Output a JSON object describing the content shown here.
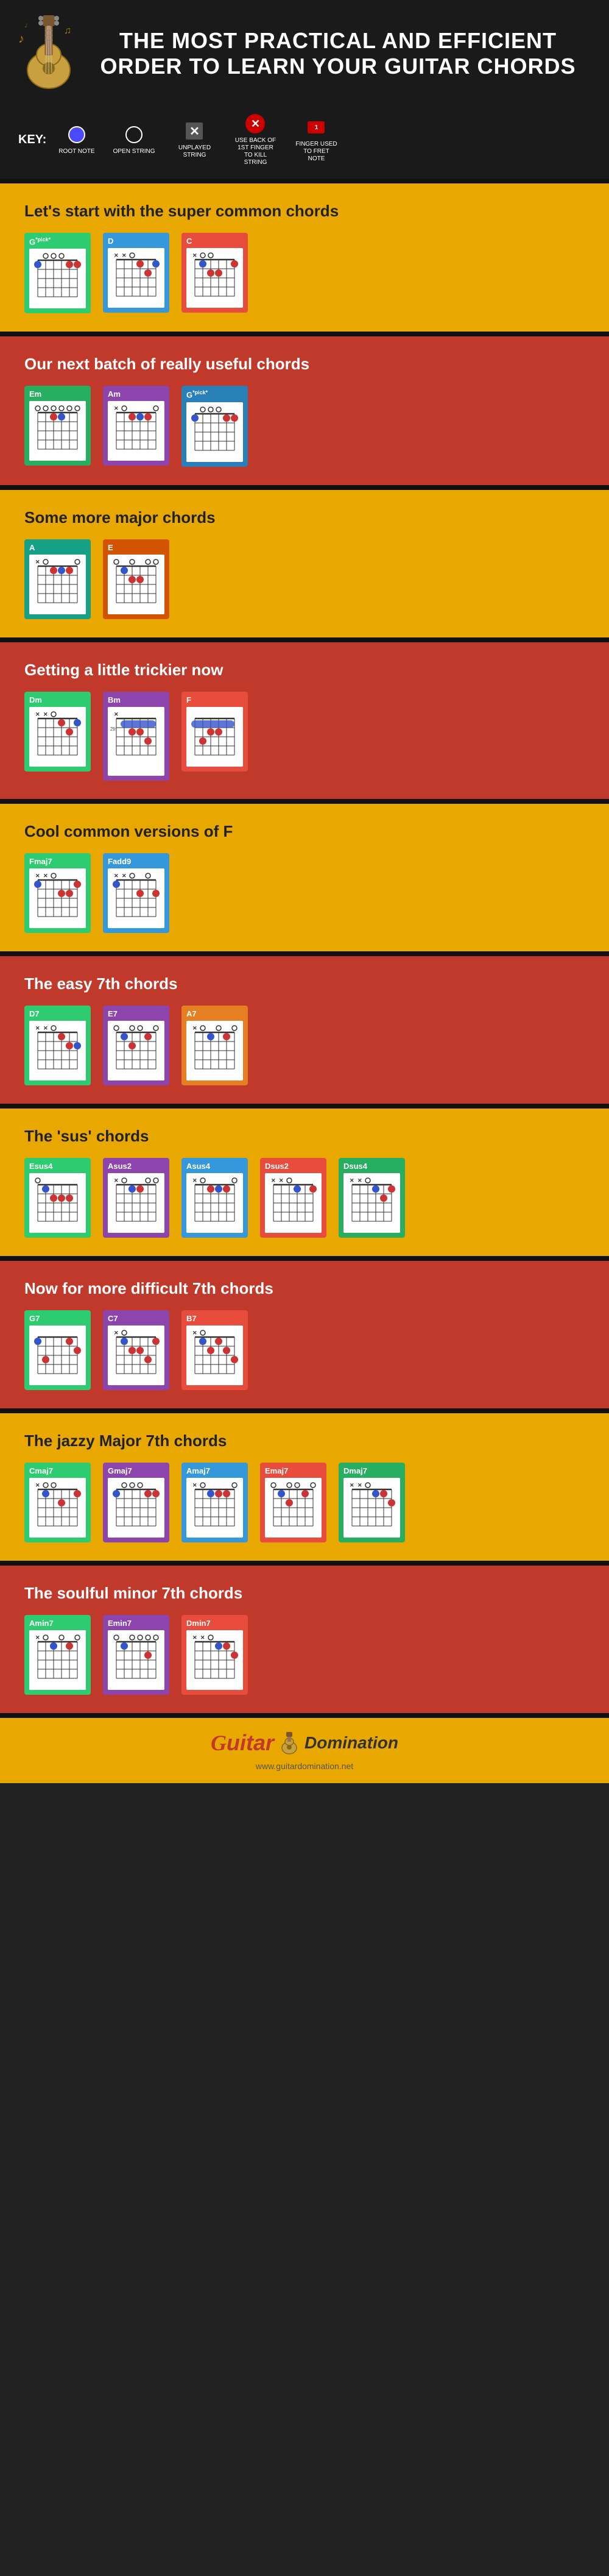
{
  "header": {
    "title": "THE MOST PRACTICAL AND EFFICIENT ORDER TO LEARN YOUR GUITAR CHORDS",
    "key_label": "KEY:"
  },
  "key_items": [
    {
      "id": "root-note",
      "type": "root",
      "label": "ROOT NOTE"
    },
    {
      "id": "open-string",
      "type": "open",
      "label": "OPEN STRING"
    },
    {
      "id": "unplayed",
      "type": "x",
      "label": "UNPLAYED STRING"
    },
    {
      "id": "kill-string",
      "type": "kill",
      "label": "USE BACK OF 1ST FINGER TO KILL STRING"
    },
    {
      "id": "fret-note",
      "type": "fret",
      "label": "FINGER USED TO FRET NOTE"
    }
  ],
  "sections": [
    {
      "id": "super-common",
      "bg": "yellow",
      "title": "Let's start with the super common chords",
      "chords": [
        "G*pick*",
        "D",
        "C"
      ]
    },
    {
      "id": "really-useful",
      "bg": "red",
      "title": "Our next batch of really useful chords",
      "chords": [
        "Em",
        "Am",
        "G*pick*"
      ]
    },
    {
      "id": "major-chords",
      "bg": "yellow",
      "title": "Some more major chords",
      "chords": [
        "A",
        "E"
      ]
    },
    {
      "id": "trickier",
      "bg": "red",
      "title": "Getting a little trickier now",
      "chords": [
        "Dm",
        "Bm",
        "F"
      ]
    },
    {
      "id": "cool-f",
      "bg": "yellow",
      "title": "Cool common versions of F",
      "chords": [
        "Fmaj7",
        "Fadd9"
      ]
    },
    {
      "id": "easy-7th",
      "bg": "red",
      "title": "The easy 7th chords",
      "chords": [
        "D7",
        "E7",
        "A7"
      ]
    },
    {
      "id": "sus-chords",
      "bg": "yellow",
      "title": "The 'sus' chords",
      "chords": [
        "Esus4",
        "Asus2",
        "Asus4",
        "Dsus2",
        "Dsus4"
      ]
    },
    {
      "id": "difficult-7th",
      "bg": "red",
      "title": "Now for more difficult 7th chords",
      "chords": [
        "G7",
        "C7",
        "B7"
      ]
    },
    {
      "id": "jazzy-major7",
      "bg": "yellow",
      "title": "The jazzy Major 7th chords",
      "chords": [
        "Cmaj7",
        "Gmaj7",
        "Amaj7",
        "Emaj7",
        "Dmaj7"
      ]
    },
    {
      "id": "soulful-minor7",
      "bg": "red",
      "title": "The soulful minor 7th chords",
      "chords": [
        "Amin7",
        "Emin7",
        "Dmin7"
      ]
    }
  ],
  "footer": {
    "brand": "Guitar",
    "sub": "Domination",
    "url": "www.guitardomination.net"
  }
}
